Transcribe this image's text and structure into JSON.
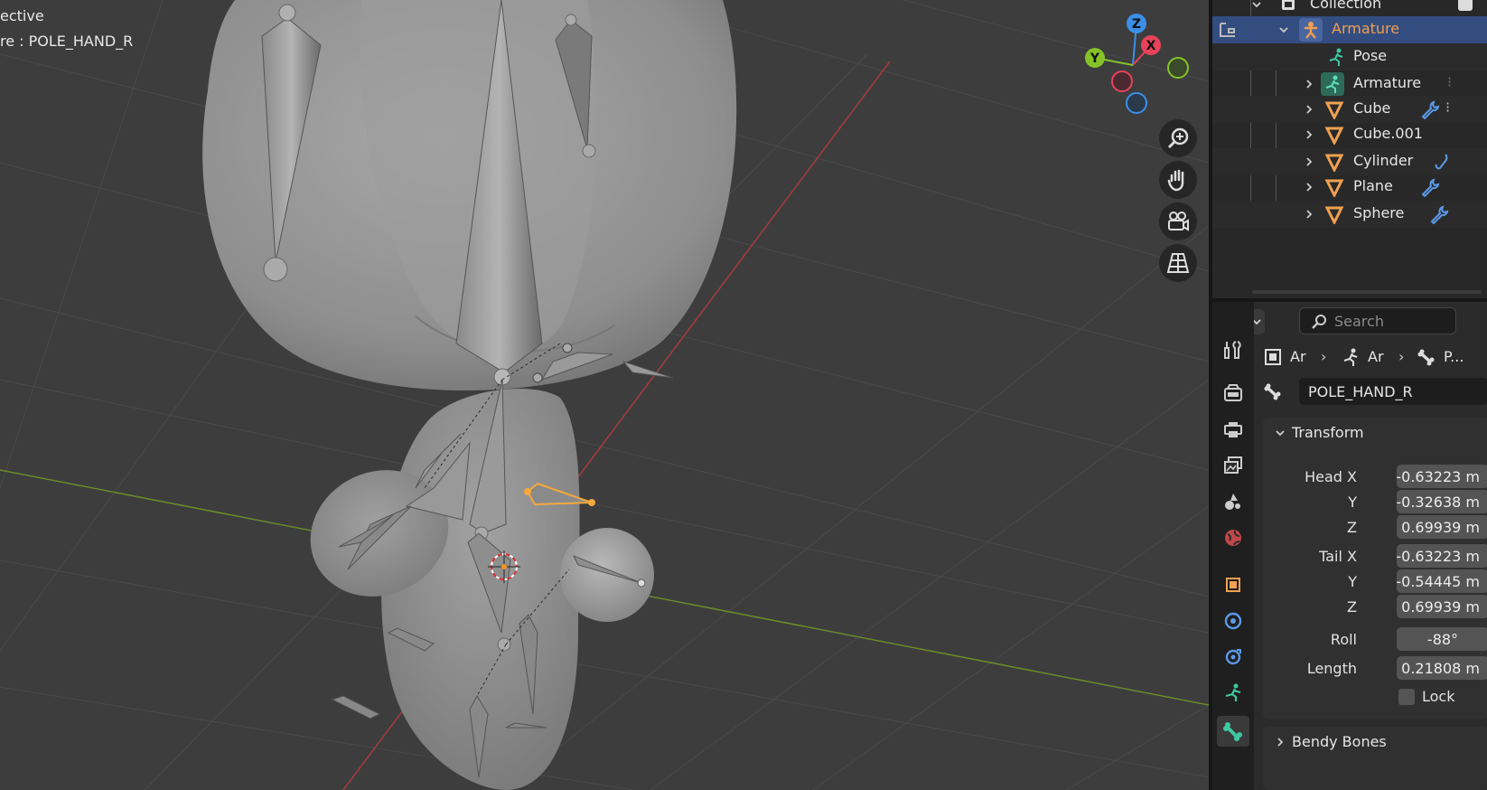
{
  "viewport": {
    "mode_text": "ective",
    "active_text": "re : POLE_HAND_R",
    "gizmo": {
      "z": "Z",
      "y": "Y",
      "x": "X"
    },
    "nav_icons": [
      "zoom-icon",
      "hand-icon",
      "camera-icon",
      "grid-icon"
    ]
  },
  "outliner": {
    "items": [
      {
        "label": "Collection"
      },
      {
        "label": "Armature",
        "selected": true
      },
      {
        "label": "Pose"
      },
      {
        "label": "Armature"
      },
      {
        "label": "Cube"
      },
      {
        "label": "Cube.001"
      },
      {
        "label": "Cylinder"
      },
      {
        "label": "Plane"
      },
      {
        "label": "Sphere"
      }
    ]
  },
  "properties": {
    "search_placeholder": "Search",
    "breadcrumb": [
      "Ar",
      "Ar",
      "P..."
    ],
    "bone_name": "POLE_HAND_R",
    "transform": {
      "title": "Transform",
      "head_x_label": "Head X",
      "head_x": "-0.63223 m",
      "head_y_label": "Y",
      "head_y": "-0.32638 m",
      "head_z_label": "Z",
      "head_z": "0.69939 m",
      "tail_x_label": "Tail X",
      "tail_x": "-0.63223 m",
      "tail_y_label": "Y",
      "tail_y": "-0.54445 m",
      "tail_z_label": "Z",
      "tail_z": "0.69939 m",
      "roll_label": "Roll",
      "roll": "-88°",
      "length_label": "Length",
      "length": "0.21808 m",
      "lock_label": "Lock"
    },
    "bendy_title": "Bendy Bones"
  },
  "colors": {
    "selection": "#334d80",
    "active_text": "#f0a050",
    "axis_x": "#e8425b",
    "axis_y": "#85c227",
    "axis_z": "#3b8fe8",
    "bone_select": "#f3a93c"
  }
}
